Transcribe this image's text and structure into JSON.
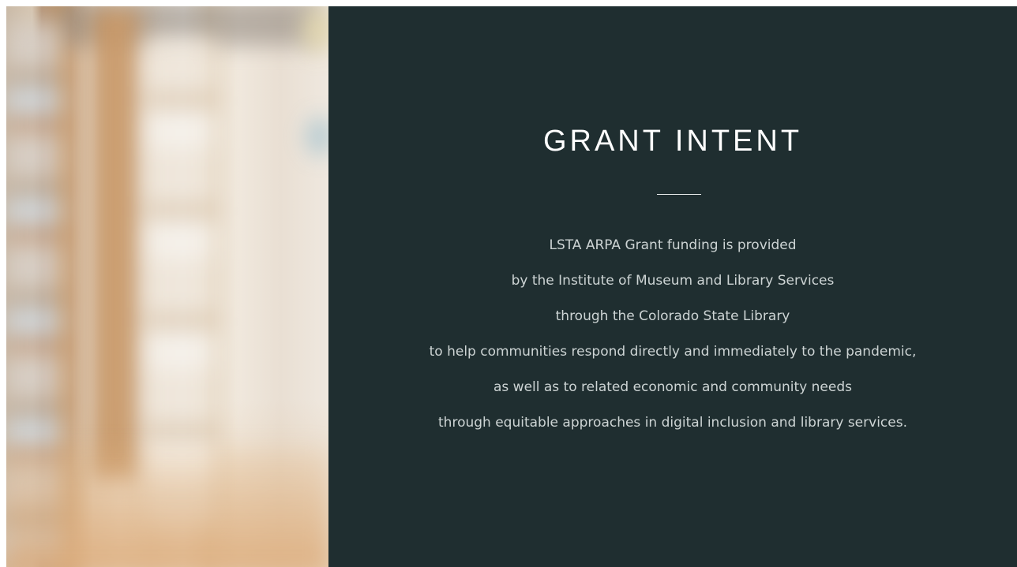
{
  "slide": {
    "title": "GRANT INTENT",
    "lines": [
      "LSTA ARPA Grant funding is provided",
      "by the Institute of Museum and Library Services",
      "through the Colorado State Library",
      "to help communities respond directly and immediately to the pandemic,",
      "as well as to related economic and community needs",
      "through equitable approaches in digital inclusion and library services."
    ],
    "colors": {
      "background": "#1f2e30",
      "title": "#ffffff",
      "body_text": "#cdd4d4"
    }
  }
}
